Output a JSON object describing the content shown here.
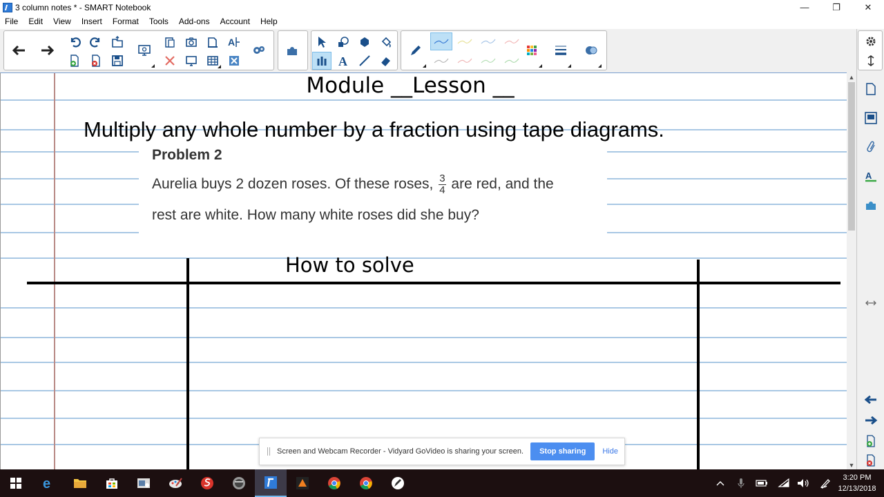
{
  "window": {
    "title": "3 column notes * - SMART Notebook",
    "minimize": "—",
    "restore": "❐",
    "close": "✕"
  },
  "menu": [
    "File",
    "Edit",
    "View",
    "Insert",
    "Format",
    "Tools",
    "Add-ons",
    "Account",
    "Help"
  ],
  "page": {
    "heading": "Module __Lesson __",
    "objective": "Multiply any whole number by a fraction using tape diagrams.",
    "problem_title": "Problem 2",
    "problem_line1_before": "Aurelia buys 2 dozen roses.  Of these roses,",
    "fraction_num": "3",
    "fraction_den": "4",
    "problem_line1_after": "are red, and the",
    "problem_line2": "rest are white.  How many white roses did she buy?",
    "column_header": "How to solve"
  },
  "share_bar": {
    "message": "Screen and Webcam Recorder - Vidyard GoVideo is sharing your screen.",
    "stop_label": "Stop sharing",
    "hide_label": "Hide"
  },
  "taskbar": {
    "time": "3:20 PM",
    "date": "12/13/2018"
  },
  "colors": {
    "ruled_line": "#a9c8e4",
    "margin_line": "#b98a86",
    "accent": "#4c8ef0",
    "taskbar": "#1c0f10"
  }
}
